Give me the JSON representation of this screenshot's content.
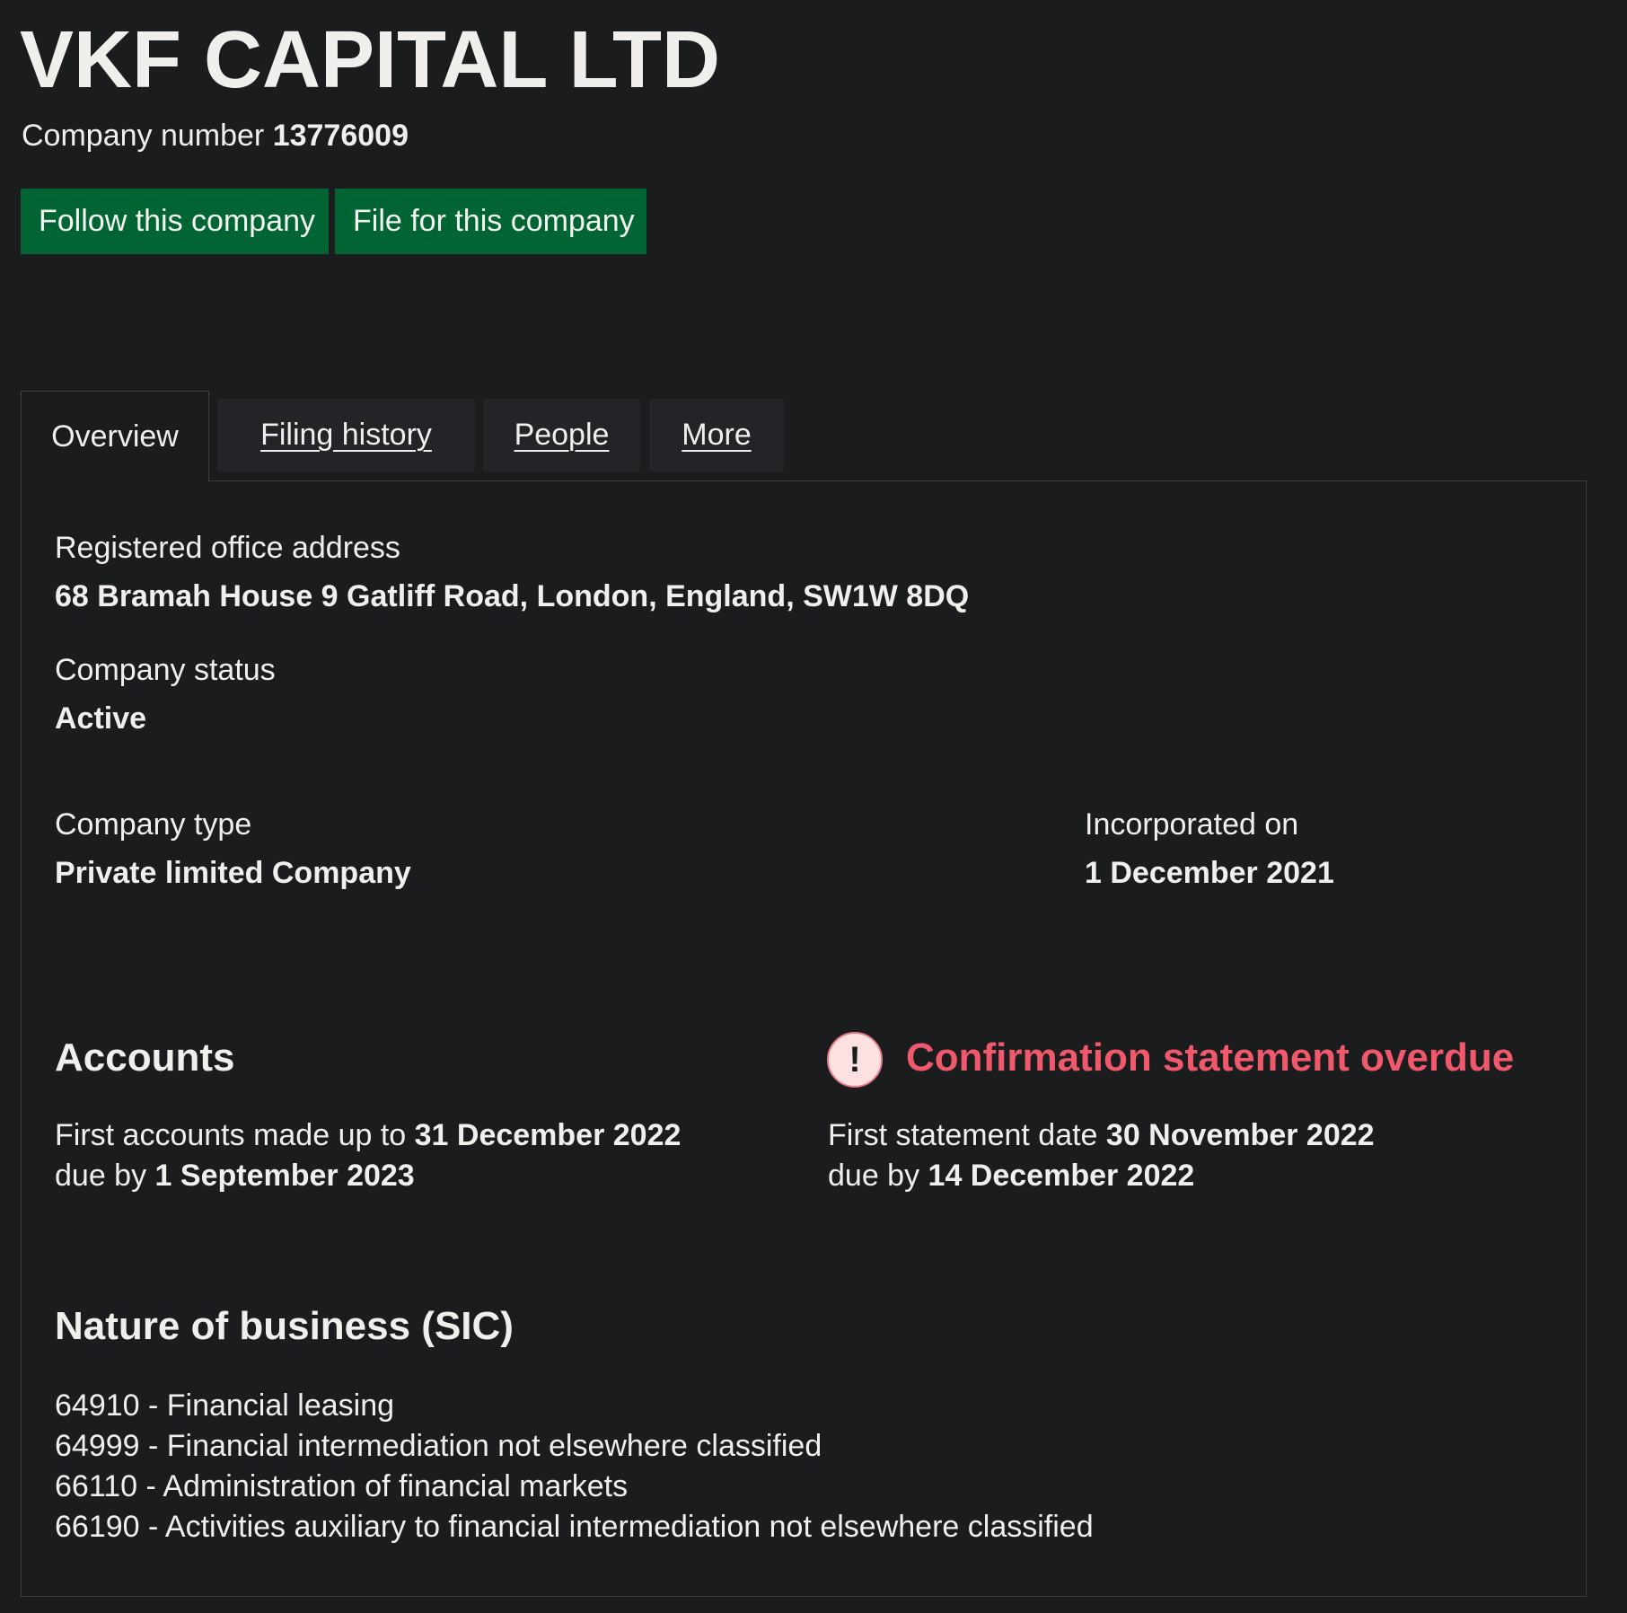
{
  "header": {
    "company_name": "VKF CAPITAL LTD",
    "company_number_label": "Company number",
    "company_number": "13776009"
  },
  "actions": {
    "follow_label": "Follow this company",
    "file_label": "File for this company"
  },
  "tabs": [
    {
      "label": "Overview",
      "active": true
    },
    {
      "label": "Filing history",
      "active": false
    },
    {
      "label": "People",
      "active": false
    },
    {
      "label": "More",
      "active": false
    }
  ],
  "overview": {
    "registered_office_label": "Registered office address",
    "registered_office": "68 Bramah House 9 Gatliff Road, London, England, SW1W 8DQ",
    "status_label": "Company status",
    "status": "Active",
    "type_label": "Company type",
    "type": "Private limited Company",
    "incorporated_label": "Incorporated on",
    "incorporated": "1 December 2021"
  },
  "accounts": {
    "heading": "Accounts",
    "first_accounts_prefix": "First accounts made up to",
    "first_accounts_date": "31 December 2022",
    "due_prefix": "due by",
    "due_date": "1 September 2023"
  },
  "confirmation": {
    "heading": "Confirmation statement overdue",
    "icon_glyph": "!",
    "first_statement_prefix": "First statement date",
    "first_statement_date": "30 November 2022",
    "due_prefix": "due by",
    "due_date": "14 December 2022"
  },
  "sic": {
    "heading": "Nature of business (SIC)",
    "items": [
      "64910 - Financial leasing",
      "64999 - Financial intermediation not elsewhere classified",
      "66110 - Administration of financial markets",
      "66190 - Activities auxiliary to financial intermediation not elsewhere classified"
    ]
  },
  "colors": {
    "background": "#1b1c1e",
    "button_green": "#006533",
    "warning_red": "#f0596c"
  }
}
